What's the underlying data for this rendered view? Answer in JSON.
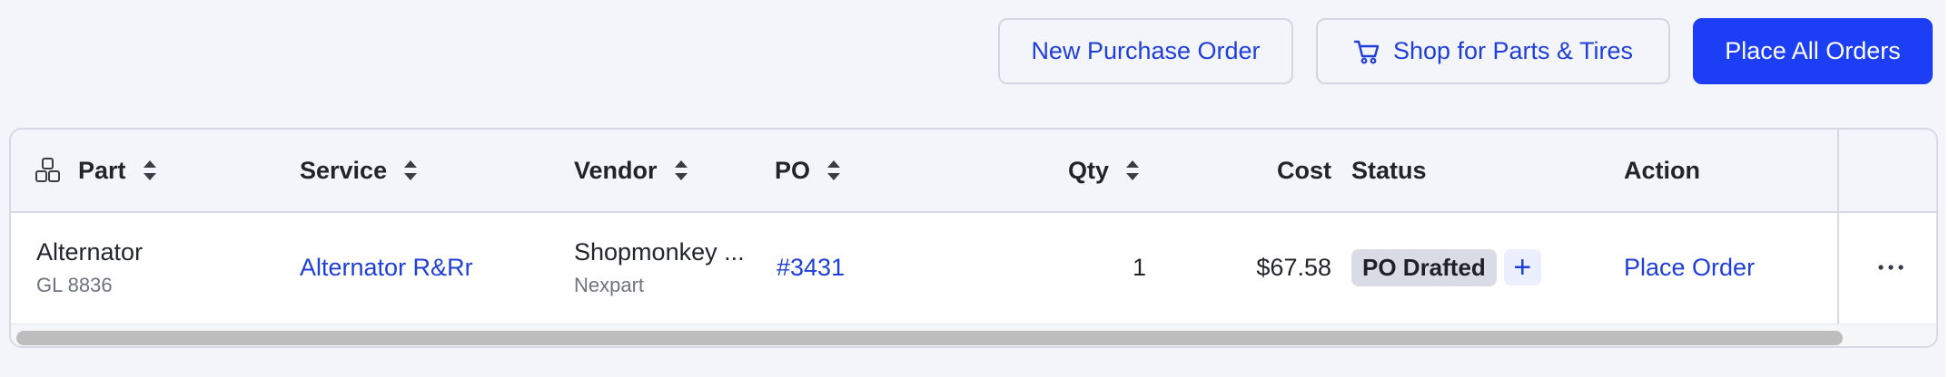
{
  "toolbar": {
    "new_po_label": "New Purchase Order",
    "shop_label": "Shop for Parts & Tires",
    "place_all_label": "Place All Orders",
    "shop_icon": "cart-icon"
  },
  "colors": {
    "primary": "#1c3ff5",
    "link": "#1f3fd8",
    "badge_bg": "#d9dbe5",
    "header_bg": "#f4f5fb"
  },
  "table": {
    "headers": {
      "part": "Part",
      "service": "Service",
      "vendor": "Vendor",
      "po": "PO",
      "qty": "Qty",
      "cost": "Cost",
      "status": "Status",
      "action": "Action"
    },
    "part_header_icon": "parts-boxes-icon",
    "rows": [
      {
        "part_name": "Alternator",
        "part_number": "GL 8836",
        "service": "Alternator R&Rr",
        "vendor_name": "Shopmonkey ...",
        "vendor_source": "Nexpart",
        "po": "#3431",
        "qty": "1",
        "cost": "$67.58",
        "status": "PO Drafted",
        "status_add": "+",
        "action": "Place Order"
      }
    ]
  }
}
